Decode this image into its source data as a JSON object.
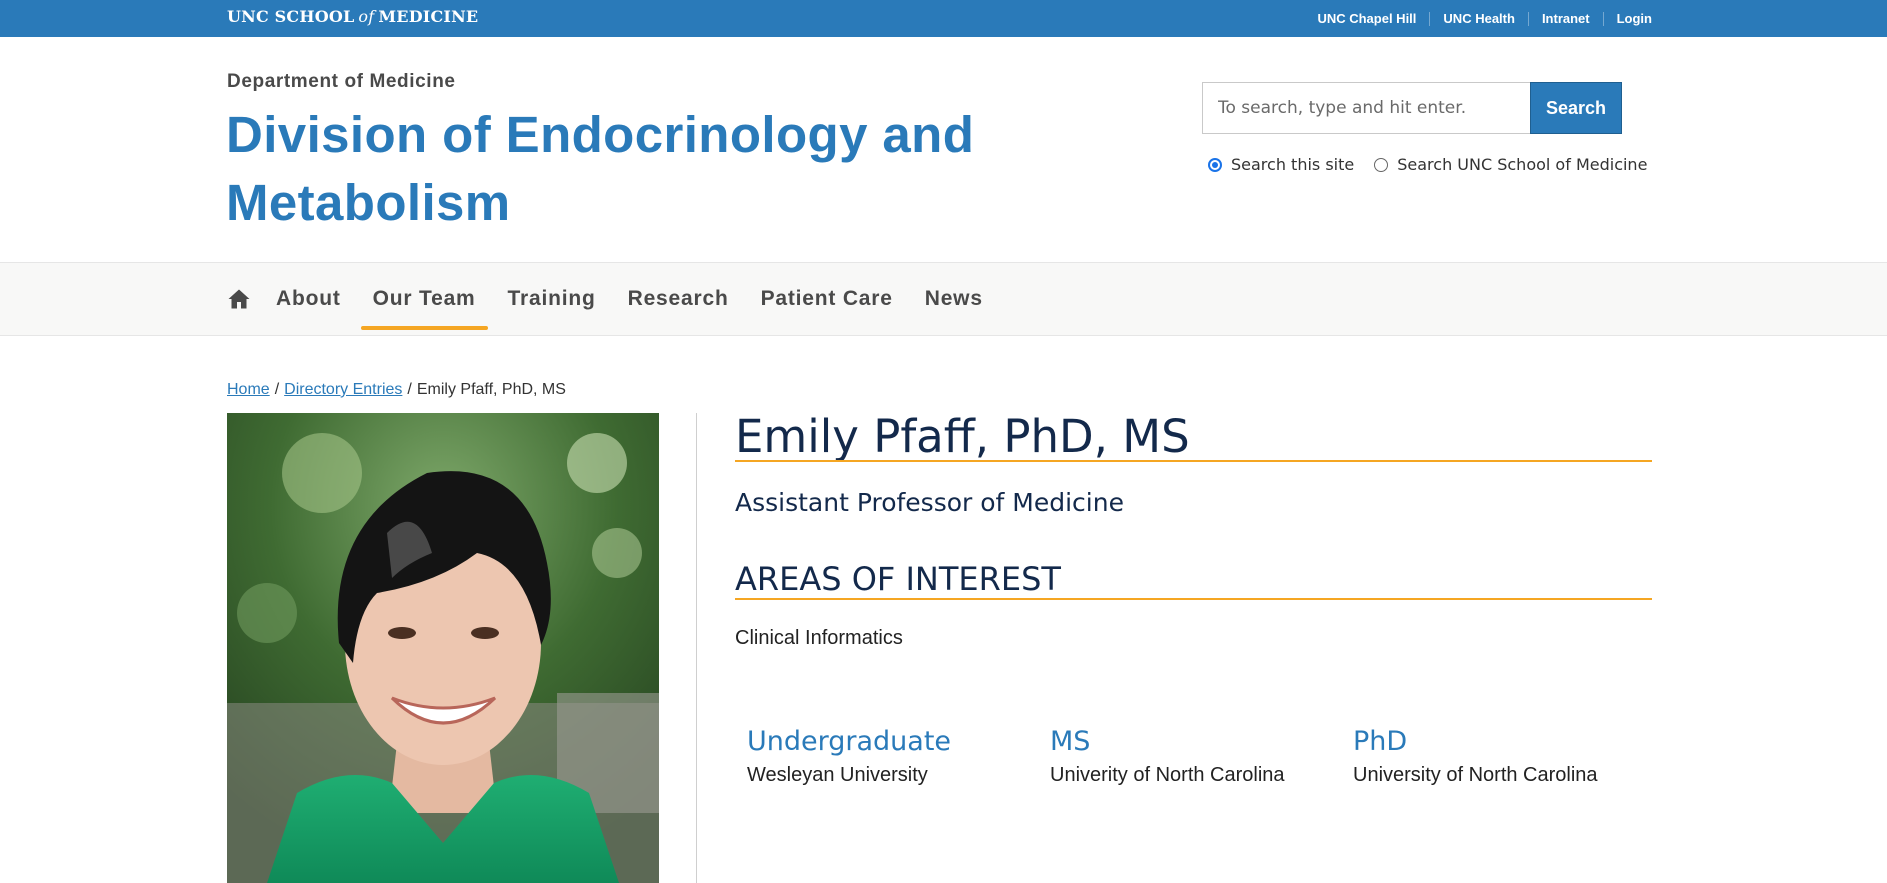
{
  "utility": {
    "brand": {
      "part1": "UNC SCHOOL",
      "part2": "of",
      "part3": "MEDICINE"
    },
    "links": [
      "UNC Chapel Hill",
      "UNC Health",
      "Intranet",
      "Login"
    ]
  },
  "header": {
    "department": "Department of Medicine",
    "title": "Division of Endocrinology and Metabolism"
  },
  "search": {
    "placeholder": "To search, type and hit enter.",
    "button": "Search",
    "scope_options": [
      "Search this site",
      "Search UNC School of Medicine"
    ],
    "selected_scope": "Search this site"
  },
  "nav": {
    "items": [
      "About",
      "Our Team",
      "Training",
      "Research",
      "Patient Care",
      "News"
    ],
    "active": "Our Team"
  },
  "breadcrumb": {
    "home": "Home",
    "section": "Directory Entries",
    "current": "Emily Pfaff, PhD, MS",
    "separator": "/"
  },
  "profile": {
    "name": "Emily Pfaff, PhD, MS",
    "title": "Assistant Professor of Medicine",
    "areas_heading": "AREAS OF INTEREST",
    "areas": [
      "Clinical Informatics"
    ],
    "education": [
      {
        "degree": "Undergraduate",
        "school": "Wesleyan University"
      },
      {
        "degree": "MS",
        "school": "Univerity of North Carolina"
      },
      {
        "degree": "PhD",
        "school": "University of North Carolina"
      }
    ]
  },
  "colors": {
    "brand_blue": "#2a7ab9",
    "navy": "#13294b",
    "accent_orange": "#f5a623",
    "nav_bg": "#f8f8f7"
  }
}
